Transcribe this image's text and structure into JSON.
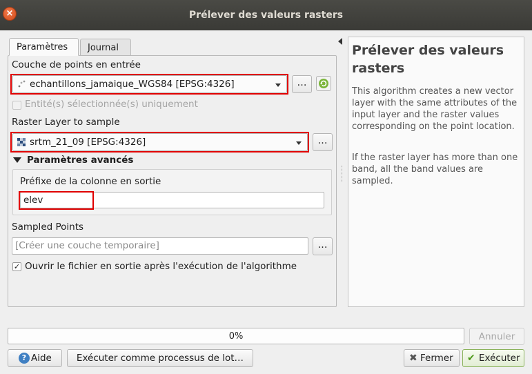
{
  "window": {
    "title": "Prélever des valeurs rasters",
    "close_glyph": "×"
  },
  "tabs": [
    {
      "label": "Paramètres"
    },
    {
      "label": "Journal"
    }
  ],
  "form": {
    "point_layer_label": "Couche de points en entrée",
    "point_layer_value": "echantillons_jamaique_WGS84 [EPSG:4326]",
    "selected_only_label": "Entité(s) sélectionnée(s) uniquement",
    "raster_label": "Raster Layer to sample",
    "raster_value": "srtm_21_09 [EPSG:4326]",
    "advanced_label": "Paramètres avancés",
    "prefix_label": "Préfixe de la colonne en sortie",
    "prefix_value": "elev",
    "output_label": "Sampled Points",
    "output_placeholder": "[Créer une couche temporaire]",
    "open_output_label": "Ouvrir le fichier en sortie après l'exécution de l'algorithme",
    "browse_label": "…"
  },
  "help": {
    "title": "Prélever des valeurs rasters",
    "p1": "This algorithm creates a new vector layer with the same attributes of the input layer and the raster values corresponding on the point location.",
    "p2": "If the raster layer has more than one band, all the band values are sampled."
  },
  "footer": {
    "progress_text": "0%",
    "cancel_label": "Annuler",
    "help_label": "Aide",
    "batch_label": "Exécuter comme processus de lot…",
    "close_label": "Fermer",
    "run_label": "Exécuter"
  },
  "colors": {
    "highlight": "#e00000",
    "titlebar": "#3c3b37"
  }
}
